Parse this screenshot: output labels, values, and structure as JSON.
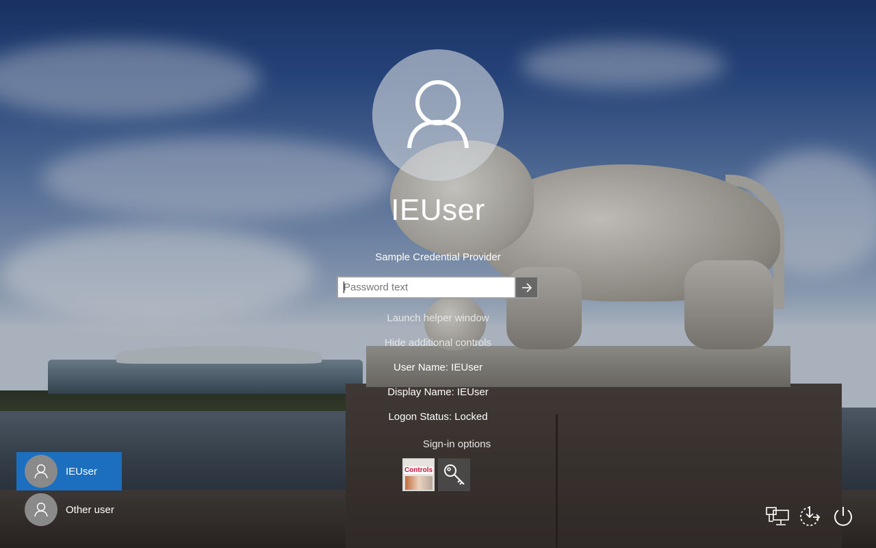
{
  "logon": {
    "username": "IEUser",
    "provider_label": "Sample Credential Provider",
    "password_placeholder": "Password text",
    "password_value": "",
    "launch_helper": "Launch helper window",
    "hide_controls": "Hide additional controls",
    "user_name_line": "User Name: IEUser",
    "display_name_line": "Display Name: IEUser",
    "logon_status_line": "Logon Status: Locked",
    "sign_in_options_label": "Sign-in options",
    "sign_in_options": [
      {
        "name": "controls-provider",
        "label": "Controls",
        "icon": "controls-tile-icon"
      },
      {
        "name": "password-provider",
        "icon": "key-icon"
      }
    ]
  },
  "user_list": [
    {
      "name": "IEUser",
      "selected": true,
      "icon": "user-icon"
    },
    {
      "name": "Other user",
      "selected": false,
      "icon": "user-icon"
    }
  ],
  "system_buttons": [
    {
      "name": "network",
      "icon": "network-icon"
    },
    {
      "name": "ease-of-access",
      "icon": "ease-of-access-icon"
    },
    {
      "name": "power",
      "icon": "power-icon"
    }
  ],
  "colors": {
    "selected_user_bg": "#1c6fbf",
    "submit_bg": "#5f5f5f"
  }
}
